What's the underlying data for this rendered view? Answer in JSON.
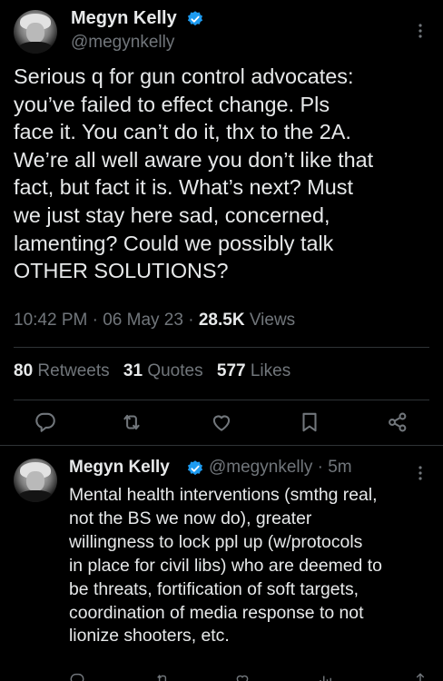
{
  "main_tweet": {
    "author_name": "Megyn Kelly",
    "handle": "@megynkelly",
    "text": "Serious q for gun control advocates:\nyou’ve failed to effect change. Pls\nface it. You can’t do it, thx to the 2A.\nWe’re all well aware you don’t like that\nfact, but fact it is. What’s next? Must\nwe just stay here sad, concerned,\nlamenting? Could we possibly talk\nOTHER SOLUTIONS?",
    "time": "10:42 PM",
    "sep": "·",
    "date": "06 May 23",
    "views_count": "28.5K",
    "views_label": "Views",
    "retweets_count": "80",
    "retweets_label": "Retweets",
    "quotes_count": "31",
    "quotes_label": "Quotes",
    "likes_count": "577",
    "likes_label": "Likes"
  },
  "reply_tweet": {
    "author_name": "Megyn Kelly",
    "handle_time": "@megynkelly · 5m",
    "text": "Mental health interventions (smthg real,\nnot the BS we now do), greater\nwillingness to lock ppl up (w/protocols\nin place for civil libs) who are deemed to\nbe threats, fortification of soft targets,\ncoordination of media response to not\nlionize shooters, etc."
  },
  "icons": [
    "verified-badge-icon",
    "more-icon",
    "reply-icon",
    "retweet-icon",
    "like-icon",
    "bookmark-icon",
    "share-icon"
  ],
  "colors": {
    "background": "#000000",
    "text": "#e7e9ea",
    "secondary": "#71767b",
    "divider": "#2f3336",
    "verified": "#1d9bf0"
  }
}
